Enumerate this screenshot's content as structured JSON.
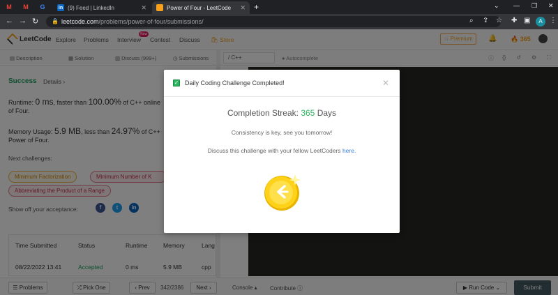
{
  "browser": {
    "tabs": [
      {
        "label": "(9) Feed | LinkedIn"
      },
      {
        "label": "Power of Four - LeetCode"
      }
    ],
    "url_host": "leetcode.com",
    "url_path": "/problems/power-of-four/submissions/",
    "profile_initial": "A"
  },
  "nav": {
    "brand": "LeetCode",
    "links": [
      "Explore",
      "Problems",
      "Interview",
      "Contest",
      "Discuss",
      "Store"
    ],
    "new_badge": "New",
    "premium": "Premium",
    "streak_count": "365"
  },
  "problem_tabs": [
    "Description",
    "Solution",
    "Discuss (999+)",
    "Submissions"
  ],
  "editor": {
    "language": "C++",
    "autocomplete": "Autocomplete"
  },
  "result": {
    "status": "Success",
    "details": "Details",
    "runtime_prefix": "Runtime:",
    "runtime_value": "0 ms",
    "runtime_mid": ", faster than",
    "runtime_pct": "100.00%",
    "runtime_suffix": "of C++ online",
    "runtime_line2": "of Four.",
    "memory_prefix": "Memory Usage:",
    "memory_value": "5.9 MB",
    "memory_mid": ", less than",
    "memory_pct": "24.97%",
    "memory_suffix": "of C++",
    "memory_line2": "Power of Four.",
    "next_challenges_label": "Next challenges:",
    "challenges": [
      "Minimum Factorization",
      "Minimum Number of K",
      "Abbreviating the Product of a Range"
    ],
    "show_off_label": "Show off your acceptance:"
  },
  "table": {
    "headers": [
      "Time Submitted",
      "Status",
      "Runtime",
      "Memory",
      "Lang"
    ],
    "rows": [
      [
        "08/22/2022 13:41",
        "Accepted",
        "0 ms",
        "5.9 MB",
        "cpp"
      ]
    ]
  },
  "bottom": {
    "problems": "Problems",
    "pick_one": "Pick One",
    "prev": "Prev",
    "page": "342/2386",
    "next": "Next",
    "console": "Console",
    "contribute": "Contribute",
    "run_code": "Run Code",
    "submit": "Submit"
  },
  "modal": {
    "title": "Daily Coding Challenge Completed!",
    "streak_label": "Completion Streak:",
    "streak_value": "365",
    "streak_unit": "Days",
    "consistency": "Consistency is key, see you tomorrow!",
    "discuss_text": "Discuss this challenge with your fellow LeetCoders",
    "discuss_link": "here."
  },
  "colors": {
    "accent_orange": "#f89f1b",
    "success_green": "#2db55d",
    "link_blue": "#3a7fd5",
    "editor_bg": "#272822"
  }
}
